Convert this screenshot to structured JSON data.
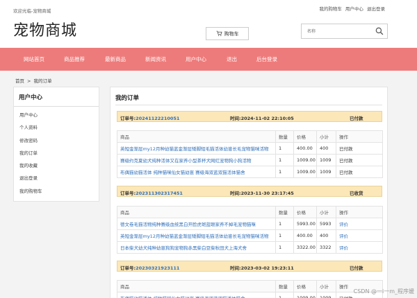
{
  "top": {
    "welcome": "欢迎光临-宠物商城",
    "links": [
      "我的购物车",
      "用户中心",
      "退出登录"
    ]
  },
  "header": {
    "logo": "宠物商城",
    "cart_label": "购物车",
    "search_placeholder": "名称"
  },
  "nav": [
    "网站首页",
    "商品推荐",
    "最新商品",
    "新闻资讯",
    "用户中心",
    "退出",
    "后台登录"
  ],
  "breadcrumb": [
    "首页",
    "我的订单"
  ],
  "sidebar": {
    "title": "用户中心",
    "items": [
      "用户中心",
      "个人资料",
      "修改密码",
      "我的订单",
      "我的收藏",
      "退出登录",
      "我的购物车"
    ]
  },
  "main": {
    "title": "我的订单",
    "headers": [
      "商品",
      "数量",
      "价格",
      "小计",
      "操作"
    ],
    "orders": [
      {
        "id_label": "订单号:",
        "id": "20241122210051",
        "time_label": "时间:",
        "time": "2024-11-02 22:10:05",
        "status": "已付款",
        "items": [
          {
            "name": "英短金渐层my12月种幼猫蓝金渐层矮脚短毛猫活体幼崽长毛宠物猫咪活物",
            "qty": "1",
            "price": "400.00",
            "subtotal": "400",
            "op": "已付款"
          },
          {
            "name": "赛级约克夏幼犬纯种活体又在家养小型茶杯犬网红宠物狗小狗活物",
            "qty": "1",
            "price": "1009.00",
            "subtotal": "1009",
            "op": "已付款"
          },
          {
            "name": "布偶猫幼猫活体 纯种猫咪仙女猫幼崽 赛级海双蓝双猫活体猫舍",
            "qty": "1",
            "price": "1009.00",
            "subtotal": "1009",
            "op": "已付款"
          }
        ]
      },
      {
        "id_label": "订单号:",
        "id": "202311302317451",
        "time_label": "时间:",
        "time": "2023-11-30 23:17:45",
        "status": "已收货",
        "items": [
          {
            "name": "德文卷毛猫活物纯种赛级血统黑白开脸虎斑蓝眼家养不掉毛宠物猫咪",
            "qty": "1",
            "price": "5993.00",
            "subtotal": "5993",
            "op": "评价"
          },
          {
            "name": "英短金渐层my12月种幼猫蓝金渐层矮脚短毛猫活体幼崽长毛宠物猫咪活物",
            "qty": "1",
            "price": "400.00",
            "subtotal": "400",
            "op": "评价"
          },
          {
            "name": "日本柴犬幼犬纯种幼崽狗狗宠物狗赤黑柴白豆柴秋田犬上海犬舍",
            "qty": "1",
            "price": "3322.00",
            "subtotal": "3322",
            "op": "评价"
          }
        ]
      },
      {
        "id_label": "订单号:",
        "id": "20230321923111",
        "time_label": "时间:",
        "time": "2023-03-02 19:23:11",
        "status": "已付款",
        "items": [
          {
            "name": "布偶猫幼猫活体 纯种猫咪仙女猫幼崽 赛级海双蓝双猫活体猫舍",
            "qty": "1",
            "price": "1009.00",
            "subtotal": "1009",
            "op": "已付款"
          }
        ]
      }
    ]
  },
  "watermark": "CSDN @一i一m_程序媛",
  "colors": {
    "nav_bg": "#ee7b7b",
    "order_bar_bg": "#fbe7b8",
    "link": "#2e6fba"
  }
}
